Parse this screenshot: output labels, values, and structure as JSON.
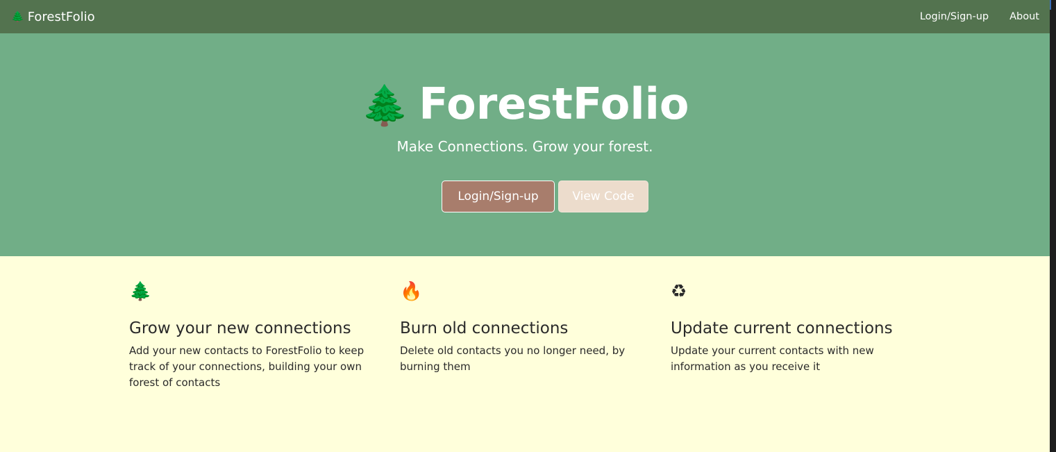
{
  "navbar": {
    "brand_icon": "🌲",
    "brand_text": "ForestFolio",
    "links": [
      "Login/Sign-up",
      "About"
    ]
  },
  "hero": {
    "icon": "🌲",
    "title": "ForestFolio",
    "subtitle": "Make Connections. Grow your forest.",
    "primary_button": "Login/Sign-up",
    "secondary_button": "View Code"
  },
  "features": [
    {
      "icon": "🌲",
      "icon_name": "tree-icon",
      "title": "Grow your new connections",
      "text": "Add your new contacts to ForestFolio to keep track of your connections, building your own forest of contacts"
    },
    {
      "icon": "🔥",
      "icon_name": "fire-icon",
      "title": "Burn old connections",
      "text": "Delete old contacts you no longer need, by burning them"
    },
    {
      "icon": "♻",
      "icon_name": "recycle-icon",
      "title": "Update current connections",
      "text": "Update your current contacts with new information as you receive it"
    }
  ],
  "colors": {
    "navbar": "#53734f",
    "hero": "#71ae87",
    "body": "#ffffdb",
    "primary_button": "#a87d6c",
    "secondary_button": "#ecdccc"
  }
}
